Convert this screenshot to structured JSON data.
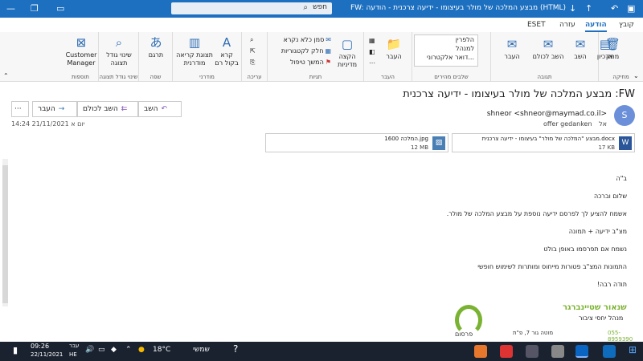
{
  "window": {
    "title": "FW: מבצע המלכה של מולר בעיצומו - ידיעה צרכנית - הודעה (HTML)",
    "search_placeholder": "חפש",
    "controls": {
      "minimize": "—",
      "restore": "❐",
      "close": "✕",
      "ribbon_display": "▭"
    }
  },
  "tabs": [
    "קובץ",
    "הודעה",
    "עזרה",
    "ESET"
  ],
  "ribbon": {
    "delete_group": {
      "label": "מחיקה",
      "delete": "מחק",
      "archive": "ארכיון"
    },
    "respond_group": {
      "label": "תגובה",
      "reply": "השב",
      "reply_all": "השב לכולם",
      "forward": "העבר"
    },
    "quicksteps_group": {
      "label": "שלבים מהירים",
      "items": [
        "הלפרין",
        "למנהל",
        "דואר אלקטרוני..."
      ]
    },
    "move_group": {
      "label": "העבר",
      "move": "העבר"
    },
    "tags_group": {
      "label": "תגיות",
      "policy": "הקצה מדיניות",
      "mark_unread": "סמן כלא נקרא",
      "categorize": "חלק לקטגוריות",
      "followup": "המשך טיפול"
    },
    "editing_group": {
      "label": "עריכה"
    },
    "speech_group": {
      "label": "מודרני",
      "read_aloud": "קרא בקול רם",
      "immersive": "תצוגת קריאה מודרנית"
    },
    "language_group": {
      "label": "שפה",
      "translate": "תרגם"
    },
    "zoom_group": {
      "label": "שינוי גודל תצוגה",
      "zoom": "שינוי גודל תצוגה"
    },
    "addins_group": {
      "label": "תוספות",
      "customer_manager": "Customer Manager"
    }
  },
  "message": {
    "subject": "מבצע המלכה של מולר בעיצומו - ידיעה צרכנית :FW",
    "actions": {
      "reply": "השב",
      "reply_all": "השב לכולם",
      "forward": "העבר",
      "more": "···"
    },
    "datestamp": "יום א 21/11/2021 14:24",
    "avatar_initial": "S",
    "sender": "shneor <shneor@maymad.co.il>",
    "to_label": "אל",
    "to": "offer gedanken",
    "attachments": [
      {
        "name": "מבצע \"המלכה של מולר\" בעיצומו - ידיעה צרכנית.docx",
        "size": "17 KB",
        "type": "W"
      },
      {
        "name": "המלכה 1600.jpg",
        "size": "12 MB",
        "type": "img"
      }
    ]
  },
  "body": {
    "lines": [
      "ב\"ה",
      "שלום וברכה",
      "אשמח להציע לך לפרסם ידיעה נוספת על מבצע המלכה של מולר.",
      "מצ\"ב ידיעה + תמונה",
      "נשמח אם תפרסמו באופן בולט",
      "התמונות המצ\"ב פטורות מייחוס ומותרות לשימוש חופשי",
      "תודה רבה!"
    ]
  },
  "signature": {
    "name": "שנאור שטיינברגר",
    "role": "מנהל יחסי ציבור",
    "phone": "055-8959390",
    "address": "מוטה גור 7, פ\"ת",
    "brand": "פרסום"
  },
  "taskbar": {
    "time": "09:26",
    "date": "22/11/2021",
    "lang": "עבר",
    "lang2": "HE",
    "temperature": "18°C",
    "weather": "שמשי"
  },
  "colors": {
    "accent": "#1d6fbf",
    "taskbar": "#1a2230",
    "brand_green": "#7ab231"
  }
}
